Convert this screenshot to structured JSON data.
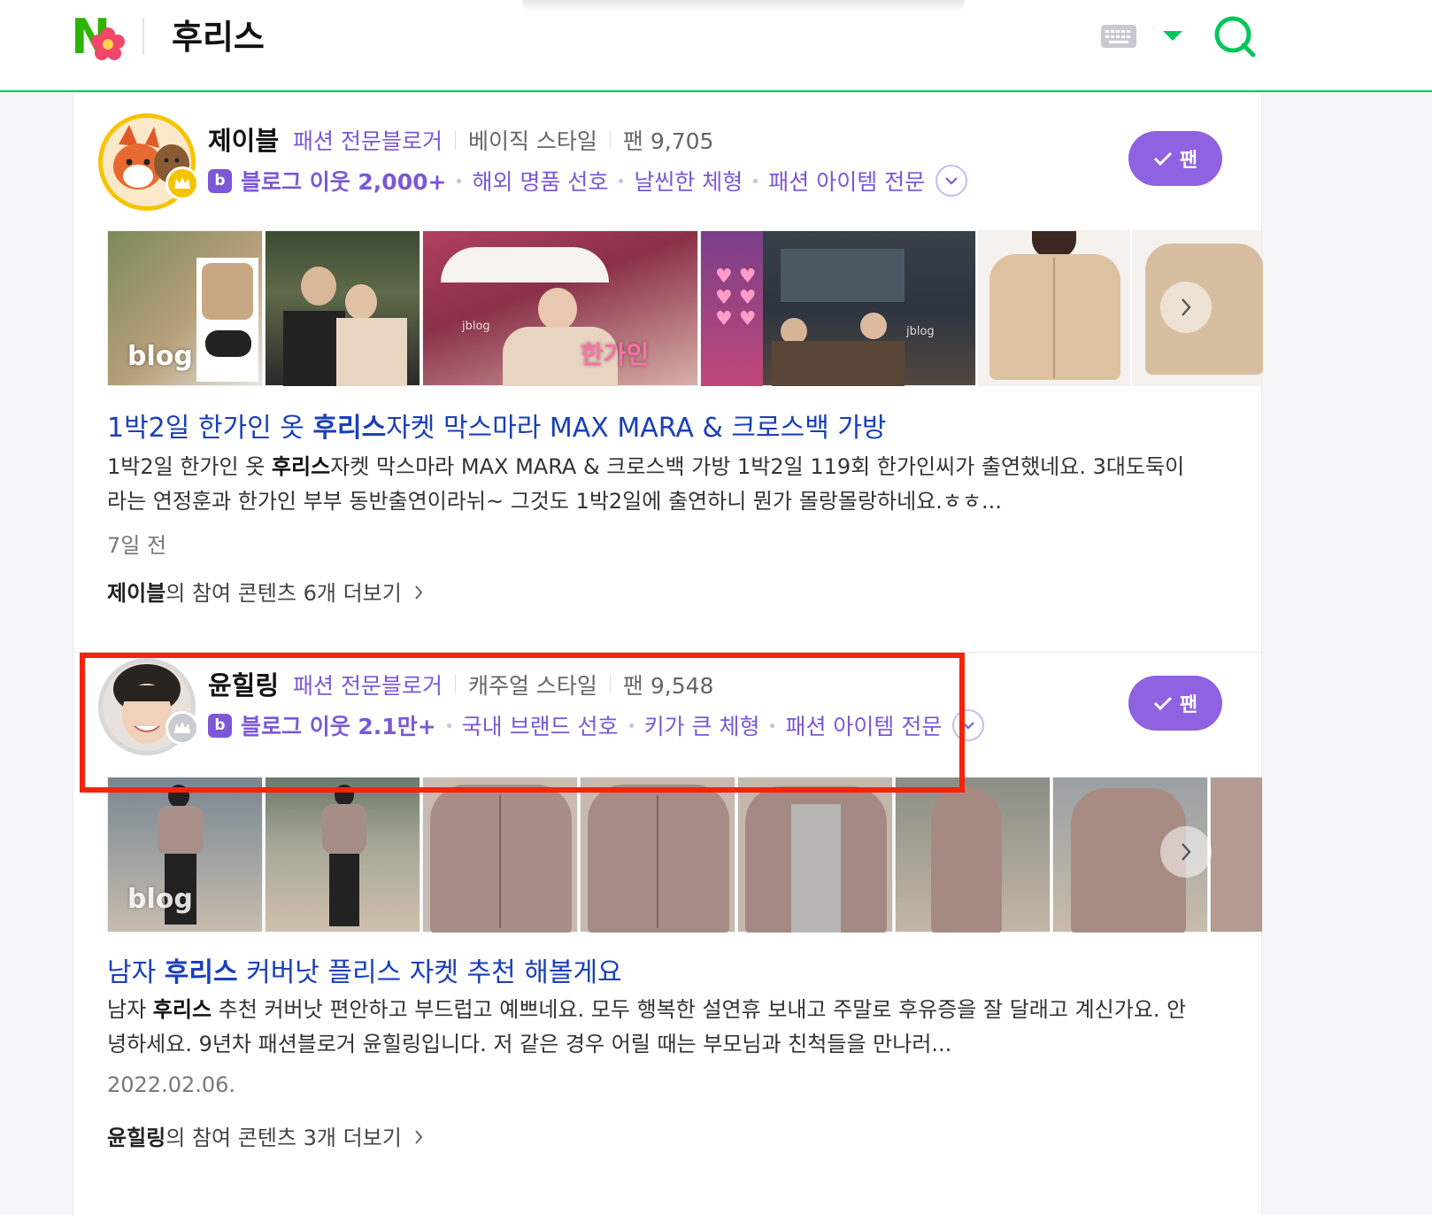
{
  "header": {
    "query": "후리스",
    "logo_letter": "N",
    "accent": "#03c75a"
  },
  "results": [
    {
      "author": "제이블",
      "category": "패션 전문블로거",
      "style": "베이직 스타일",
      "fans": "팬 9,705",
      "badge_icon": "b",
      "neighbors": "블로그 이웃 2,000+",
      "tags": [
        "해외 명품 선호",
        "날씬한 체형",
        "패션 아이템 전문"
      ],
      "fan_button": "팬",
      "title_pre": "1박2일 한가인 옷 ",
      "title_bold": "후리스",
      "title_post": "자켓 막스마라 MAX MARA & 크로스백 가방",
      "snippet_pre": "1박2일 한가인 옷 ",
      "snippet_bold": "후리스",
      "snippet_post": "자켓 막스마라 MAX MARA & 크로스백 가방 1박2일 119회 한가인씨가 출연했네요. 3대도둑이라는 연정훈과 한가인 부부 동반출연이라뉘~ 그것도 1박2일에 출연하니 뭔가 몰랑몰랑하네요.ㅎㅎ...",
      "date": "7일 전",
      "more_name": "제이블",
      "more_rest": "의 참여 콘텐츠 6개 더보기",
      "thumb_texts": [
        "blog",
        "jblog",
        "한가인",
        "jblog"
      ]
    },
    {
      "author": "윤힐링",
      "category": "패션 전문블로거",
      "style": "캐주얼 스타일",
      "fans": "팬 9,548",
      "badge_icon": "b",
      "neighbors": "블로그 이웃 2.1만+",
      "tags": [
        "국내 브랜드 선호",
        "키가 큰 체형",
        "패션 아이템 전문"
      ],
      "fan_button": "팬",
      "title_pre": "남자 ",
      "title_bold": "후리스",
      "title_post": " 커버낫 플리스 자켓 추천 해볼게요",
      "snippet_pre": "남자 ",
      "snippet_bold": "후리스",
      "snippet_post": " 추천 커버낫 편안하고 부드럽고 예쁘네요. 모두 행복한 설연휴 보내고 주말로 후유증을 잘 달래고 계신가요. 안녕하세요. 9년차 패션블로거 윤힐링입니다. 저 같은 경우 어릴 때는 부모님과 친척들을 만나러...",
      "date": "2022.02.06.",
      "more_name": "윤힐링",
      "more_rest": "의 참여 콘텐츠 3개 더보기",
      "thumb_texts": [
        "blog"
      ]
    }
  ]
}
